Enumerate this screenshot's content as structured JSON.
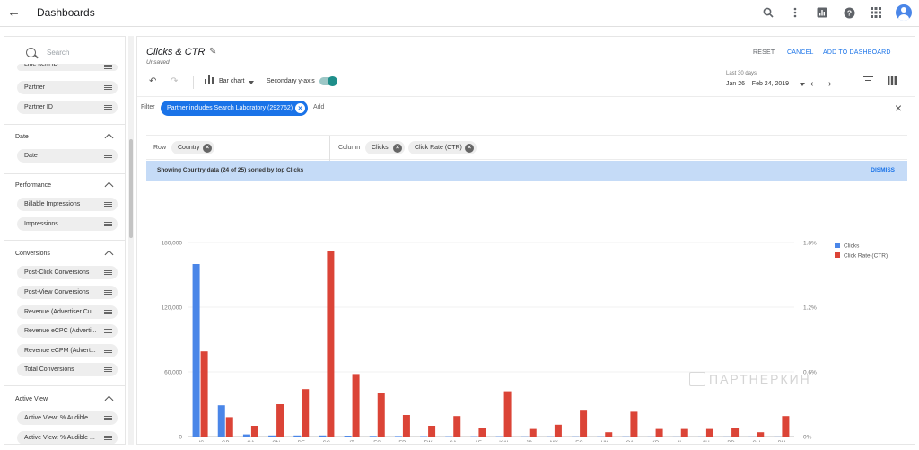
{
  "topbar": {
    "title": "Dashboards"
  },
  "sidebar": {
    "search_placeholder": "Search",
    "top_cut_item": "Line Item ID",
    "top_items": [
      "Partner",
      "Partner ID"
    ],
    "sections": [
      {
        "title": "Date",
        "items": [
          "Date"
        ]
      },
      {
        "title": "Performance",
        "items": [
          "Billable Impressions",
          "Impressions"
        ]
      },
      {
        "title": "Conversions",
        "items": [
          "Post-Click Conversions",
          "Post-View Conversions",
          "Revenue (Advertiser Cu...",
          "Revenue eCPC (Adverti...",
          "Revenue eCPM (Advert...",
          "Total Conversions"
        ]
      },
      {
        "title": "Active View",
        "items": [
          "Active View: % Audible ...",
          "Active View: % Audible ..."
        ]
      }
    ]
  },
  "header": {
    "title": "Clicks & CTR",
    "subtitle": "Unsaved",
    "reset": "RESET",
    "cancel": "CANCEL",
    "add": "ADD TO DASHBOARD"
  },
  "toolbar": {
    "chart_type": "Bar chart",
    "secondary_axis_label": "Secondary y-axis",
    "secondary_axis_on": true,
    "date_range_label": "Last 30 days",
    "date_range_value": "Jan 26 – Feb 24, 2019"
  },
  "filter": {
    "label": "Filter",
    "chip": "Partner includes Search Laboratory (292762)",
    "add": "Add"
  },
  "grouping": {
    "row_label": "Row",
    "row_chips": [
      "Country"
    ],
    "column_label": "Column",
    "column_chips": [
      "Clicks",
      "Click Rate (CTR)"
    ]
  },
  "info": {
    "text": "Showing Country data (24 of 25) sorted by top Clicks",
    "dismiss": "DISMISS"
  },
  "watermark": "ПАРТНЕРКИН",
  "colors": {
    "clicks": "#4a86e8",
    "ctr": "#db4437",
    "accent": "#1a73e8"
  },
  "chart_data": {
    "type": "bar",
    "categories": [
      "US",
      "GB",
      "CA",
      "CN",
      "DE",
      "SG",
      "IT",
      "ES",
      "FR",
      "TW",
      "SA",
      "AE",
      "KW",
      "JP",
      "MX",
      "EG",
      "HK",
      "QA",
      "KR",
      "IL",
      "AU",
      "BD",
      "CH",
      "BH"
    ],
    "series": [
      {
        "name": "Clicks",
        "axis": "left",
        "values": [
          160000,
          29000,
          2000,
          1000,
          1000,
          1000,
          800,
          600,
          500,
          400,
          300,
          300,
          300,
          200,
          200,
          200,
          200,
          200,
          100,
          100,
          100,
          100,
          100,
          100
        ]
      },
      {
        "name": "Click Rate (CTR)",
        "axis": "right",
        "values": [
          0.79,
          0.18,
          0.1,
          0.3,
          0.44,
          1.72,
          0.58,
          0.4,
          0.2,
          0.1,
          0.19,
          0.08,
          0.42,
          0.07,
          0.11,
          0.24,
          0.04,
          0.23,
          0.07,
          0.07,
          0.07,
          0.08,
          0.04,
          0.19
        ]
      }
    ],
    "left_axis": {
      "ticks": [
        "0",
        "60,000",
        "120,000",
        "180,000"
      ],
      "range": [
        0,
        180000
      ]
    },
    "right_axis": {
      "ticks": [
        "0%",
        "0.6%",
        "1.2%",
        "1.8%"
      ],
      "range": [
        0,
        1.8
      ]
    },
    "legend_position": "top-right"
  }
}
